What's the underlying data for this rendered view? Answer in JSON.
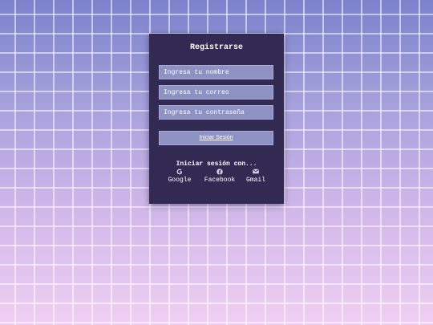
{
  "form": {
    "title": "Registrarse",
    "name_placeholder": "Ingresa tu nombre",
    "email_placeholder": "Ingresa tu correo",
    "password_placeholder": "Ingresa tu contraseña",
    "submit_label": "Iniciar Sesión"
  },
  "social": {
    "heading": "Iniciar sesión con...",
    "items": [
      {
        "label": "Google",
        "icon": "google-icon"
      },
      {
        "label": "Facebook",
        "icon": "facebook-icon"
      },
      {
        "label": "Gmail",
        "icon": "mail-icon"
      }
    ]
  },
  "colors": {
    "card": "#322a52",
    "field": "#8e92c2",
    "grid_lines": "#ffffff",
    "background_top": "#7b82cc",
    "background_bottom": "#efd0f2"
  }
}
